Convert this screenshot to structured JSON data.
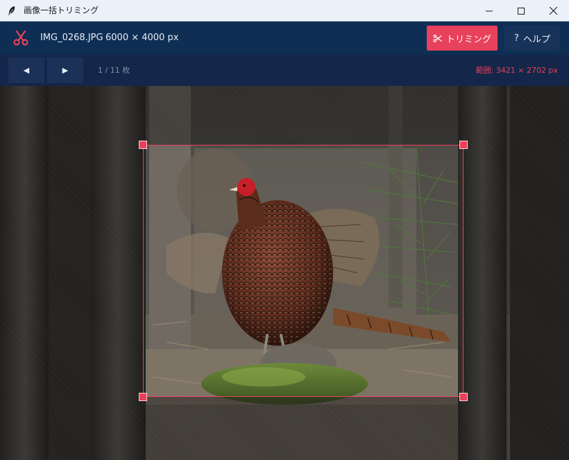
{
  "window": {
    "title": "画像一括トリミング",
    "controls": {
      "minimize": "minimize",
      "maximize": "maximize",
      "close": "close"
    }
  },
  "header": {
    "file_name": "IMG_0268.JPG",
    "image_size": "6000 × 4000 px",
    "trim_button": "トリミング",
    "help_button": "ヘルプ",
    "help_glyph": "?",
    "icons": {
      "logo": "scissors-icon",
      "trim": "scissors-icon"
    }
  },
  "toolbar": {
    "prev_glyph": "◀",
    "next_glyph": "▶",
    "counter": "1 / 11 枚",
    "range": "範囲: 3421 × 2702 px"
  },
  "colors": {
    "accent": "#e8415b",
    "header_bg": "#0f2e54",
    "toolbar_bg": "#14264a",
    "titlebar_bg": "#eaf1f9"
  }
}
